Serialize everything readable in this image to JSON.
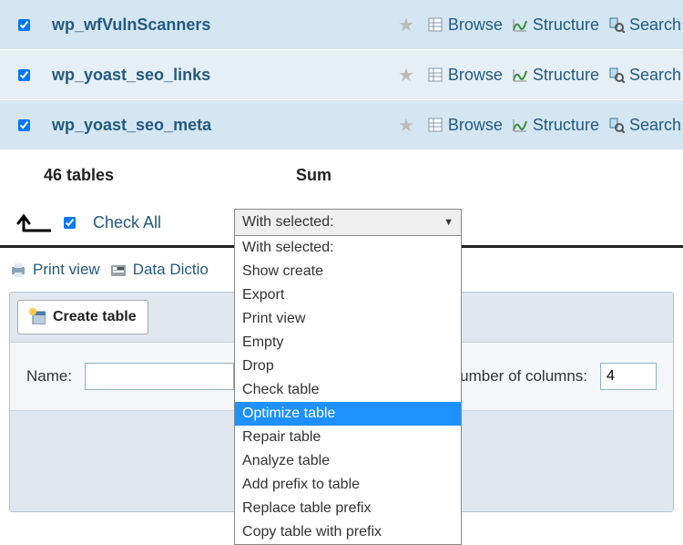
{
  "tables": [
    {
      "name": "wp_wfVulnScanners",
      "checked": true
    },
    {
      "name": "wp_yoast_seo_links",
      "checked": true
    },
    {
      "name": "wp_yoast_seo_meta",
      "checked": true
    }
  ],
  "actions": {
    "browse": "Browse",
    "structure": "Structure",
    "search": "Search"
  },
  "footer": {
    "count": "46 tables",
    "sum": "Sum"
  },
  "checkall": {
    "label": "Check All",
    "checked": true
  },
  "select": {
    "current": "With selected:",
    "options": [
      "With selected:",
      "Show create",
      "Export",
      "Print view",
      "Empty",
      "Drop",
      "Check table",
      "Optimize table",
      "Repair table",
      "Analyze table",
      "Add prefix to table",
      "Replace table prefix",
      "Copy table with prefix"
    ],
    "selected_index": 7
  },
  "tools": {
    "print_view": "Print view",
    "data_dictionary": "Data Dictio"
  },
  "create": {
    "button": "Create table",
    "name_label": "Name:",
    "name_value": "",
    "cols_label": "umber of columns:",
    "cols_value": "4"
  }
}
